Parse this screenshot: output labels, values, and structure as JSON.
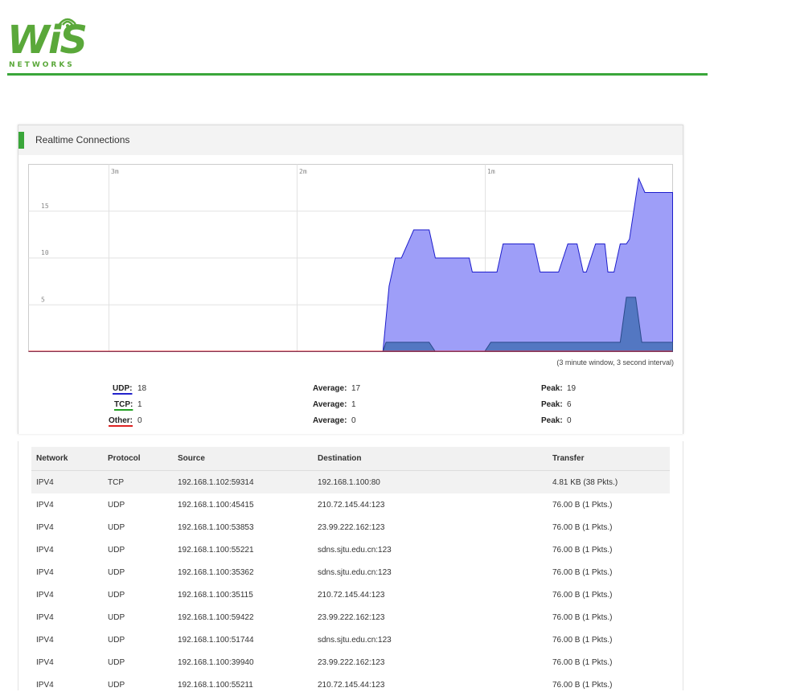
{
  "brand": {
    "name": "WiS",
    "sub": "NETWORKS",
    "color": "#5aa83a"
  },
  "panel": {
    "title": "Realtime Connections",
    "accent": "#3aa63a"
  },
  "chart_data": {
    "type": "area",
    "x_labels": [
      "3m",
      "2m",
      "1m"
    ],
    "y_ticks": [
      15,
      10,
      5
    ],
    "ylim": [
      0,
      20
    ],
    "grid": true,
    "note": "(3 minute window, 3 second interval)",
    "series": [
      {
        "name": "UDP",
        "color": "#5b5bef",
        "x": [
          0,
          115,
          117,
          119,
          120,
          121,
          125,
          130,
          132,
          143,
          144,
          145,
          152,
          154,
          164,
          166,
          172,
          175,
          178,
          180,
          181,
          184,
          187,
          188,
          189,
          190,
          192,
          194,
          195,
          198,
          200,
          201,
          204,
          205,
          206,
          207,
          209
        ],
        "values": [
          0,
          0,
          7,
          10,
          10,
          10,
          13,
          13,
          10,
          10,
          8.5,
          8.5,
          8.5,
          11.5,
          11.5,
          8.5,
          8.5,
          11.5,
          11.5,
          8.5,
          8.5,
          11.5,
          11.5,
          8.5,
          8.5,
          8.5,
          11.5,
          11.5,
          12,
          18.5,
          17,
          17,
          17,
          17,
          17,
          17,
          17
        ]
      },
      {
        "name": "TCP",
        "color": "#3a6ab0",
        "x": [
          0,
          115,
          116,
          130,
          132,
          148,
          150,
          170,
          172,
          192,
          194,
          197,
          199,
          209
        ],
        "values": [
          0,
          0,
          1,
          1,
          0,
          0,
          1,
          1,
          1,
          1,
          5.8,
          5.8,
          1,
          1
        ]
      },
      {
        "name": "Other",
        "color": "#dd2222",
        "x": [
          0,
          209
        ],
        "values": [
          0,
          0
        ]
      }
    ]
  },
  "stats": [
    {
      "label": "UDP:",
      "current": "18",
      "avg_label": "Average:",
      "avg": "17",
      "peak_label": "Peak:",
      "peak": "19",
      "color": "#2222cc"
    },
    {
      "label": "TCP:",
      "current": "1",
      "avg_label": "Average:",
      "avg": "1",
      "peak_label": "Peak:",
      "peak": "6",
      "color": "#22a022"
    },
    {
      "label": "Other:",
      "current": "0",
      "avg_label": "Average:",
      "avg": "0",
      "peak_label": "Peak:",
      "peak": "0",
      "color": "#dd2222"
    }
  ],
  "table": {
    "headers": [
      "Network",
      "Protocol",
      "Source",
      "Destination",
      "Transfer"
    ],
    "rows": [
      [
        "IPV4",
        "TCP",
        "192.168.1.102:59314",
        "192.168.1.100:80",
        "4.81 KB (38 Pkts.)"
      ],
      [
        "IPV4",
        "UDP",
        "192.168.1.100:45415",
        "210.72.145.44:123",
        "76.00 B (1 Pkts.)"
      ],
      [
        "IPV4",
        "UDP",
        "192.168.1.100:53853",
        "23.99.222.162:123",
        "76.00 B (1 Pkts.)"
      ],
      [
        "IPV4",
        "UDP",
        "192.168.1.100:55221",
        "sdns.sjtu.edu.cn:123",
        "76.00 B (1 Pkts.)"
      ],
      [
        "IPV4",
        "UDP",
        "192.168.1.100:35362",
        "sdns.sjtu.edu.cn:123",
        "76.00 B (1 Pkts.)"
      ],
      [
        "IPV4",
        "UDP",
        "192.168.1.100:35115",
        "210.72.145.44:123",
        "76.00 B (1 Pkts.)"
      ],
      [
        "IPV4",
        "UDP",
        "192.168.1.100:59422",
        "23.99.222.162:123",
        "76.00 B (1 Pkts.)"
      ],
      [
        "IPV4",
        "UDP",
        "192.168.1.100:51744",
        "sdns.sjtu.edu.cn:123",
        "76.00 B (1 Pkts.)"
      ],
      [
        "IPV4",
        "UDP",
        "192.168.1.100:39940",
        "23.99.222.162:123",
        "76.00 B (1 Pkts.)"
      ],
      [
        "IPV4",
        "UDP",
        "192.168.1.100:55211",
        "210.72.145.44:123",
        "76.00 B (1 Pkts.)"
      ]
    ]
  }
}
